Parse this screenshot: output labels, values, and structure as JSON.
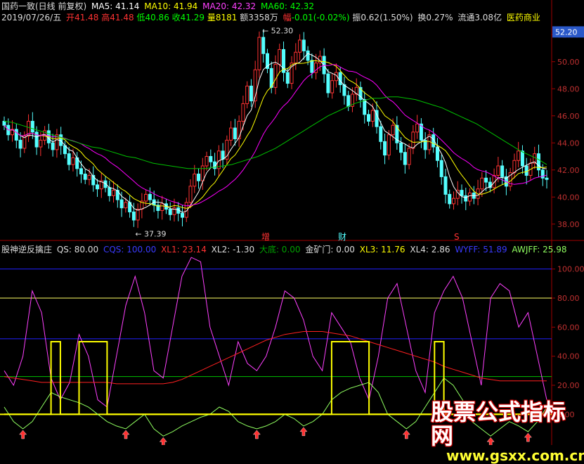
{
  "header": {
    "title": "国药一致(日线 前复权)",
    "ma5": "MA5: 41.14",
    "ma10": "MA10: 41.94",
    "ma20": "MA20: 42.32",
    "ma60": "MA60: 42.32",
    "date": "2019/07/26/五",
    "open_label": "开",
    "open": "41.48",
    "high_label": "高",
    "high": "41.48",
    "low_label": "低",
    "low": "40.86",
    "close_label": "收",
    "close": "41.29",
    "vol_label": "量",
    "vol": "8181",
    "amount": "额3358万",
    "change_label": "幅",
    "change": "-0.01(-0.02%)",
    "amplitude": "振0.62(1.50%)",
    "turnover": "换0.27%",
    "float": "流通3.08亿",
    "industry": "医药商业"
  },
  "price_labels": {
    "high_mark": "52.30",
    "low_mark": "37.39",
    "current": "52.20",
    "event1": "增",
    "event2": "财",
    "event3": "S"
  },
  "indicator": {
    "name": "股神逆反擒庄",
    "qs": "QS: 80.00",
    "cqs": "CQS: 100.00",
    "xl1": "XL1: 23.14",
    "xl2": "XL2: -1.30",
    "dadi": "大底: 0.00",
    "jkm": "金矿门: 0.00",
    "xl3": "XL3: 11.76",
    "xl4": "XL4: 2.86",
    "wyff": "WYFF: 51.89",
    "awjff": "AWJFF: 25.98"
  },
  "watermark": {
    "text": "股票公式指标网",
    "url": "www.gsxx.com.cn"
  },
  "colors": {
    "up": "#ff3232",
    "down": "#54ffff",
    "ma5": "#ffffff",
    "ma10": "#ffff00",
    "ma20": "#ff00ff",
    "ma60": "#00c000"
  },
  "chart_data": [
    {
      "type": "candlestick",
      "title": "国药一致(日线 前复权)",
      "ylim": [
        37,
        53
      ],
      "yticks": [
        38,
        40,
        42,
        44,
        46,
        48,
        50,
        52
      ],
      "annotations": [
        {
          "label": "52.30",
          "value": 52.3
        },
        {
          "label": "37.39",
          "value": 37.39
        }
      ],
      "close": [
        45.3,
        44.6,
        45.0,
        44.2,
        43.6,
        44.5,
        45.6,
        44.8,
        43.7,
        44.2,
        44.9,
        44.0,
        43.5,
        44.6,
        43.8,
        43.2,
        42.4,
        42.9,
        42.1,
        41.7,
        41.3,
        41.6,
        40.9,
        40.6,
        41.2,
        40.7,
        40.1,
        40.5,
        39.8,
        39.2,
        39.6,
        38.9,
        38.3,
        39.1,
        39.7,
        40.2,
        39.8,
        39.4,
        39.0,
        39.5,
        39.1,
        38.7,
        39.2,
        38.8,
        38.5,
        39.6,
        40.8,
        41.7,
        41.2,
        42.3,
        43.0,
        42.6,
        42.1,
        43.4,
        42.8,
        44.2,
        45.1,
        44.3,
        45.6,
        46.9,
        48.2,
        47.1,
        49.4,
        51.8,
        50.6,
        49.5,
        48.1,
        49.8,
        50.9,
        49.2,
        48.4,
        49.9,
        50.7,
        51.6,
        50.8,
        50.1,
        49.2,
        49.9,
        50.4,
        49.1,
        47.7,
        48.6,
        49.2,
        48.3,
        47.5,
        46.7,
        47.6,
        48.1,
        47.2,
        46.1,
        45.6,
        46.4,
        45.2,
        44.1,
        43.1,
        44.6,
        45.3,
        44.0,
        43.3,
        42.4,
        43.6,
        44.8,
        45.4,
        44.2,
        43.5,
        44.6,
        43.7,
        42.7,
        41.5,
        40.2,
        39.5,
        39.9,
        40.5,
        40.1,
        39.7,
        40.3,
        39.9,
        40.6,
        41.4,
        41.1,
        40.7,
        41.6,
        42.3,
        41.5,
        40.8,
        41.8,
        42.7,
        43.4,
        42.3,
        41.6,
        42.5,
        43.2,
        42.0,
        41.4,
        41.3
      ],
      "ma60": [
        45.6,
        45.5,
        45.3,
        45.1,
        44.9,
        44.7,
        44.5,
        44.3,
        44.1,
        43.9,
        43.7,
        43.6,
        43.4,
        43.2,
        43.0,
        42.9,
        42.7,
        42.5,
        42.4,
        42.3,
        42.2,
        42.1,
        42.1,
        42.1,
        42.2,
        42.3,
        42.4,
        42.6,
        42.8,
        43.0,
        43.3,
        43.6,
        44.0,
        44.4,
        44.8,
        45.2,
        45.6,
        46.0,
        46.3,
        46.6,
        46.9,
        47.1,
        47.3,
        47.3,
        47.4,
        47.4,
        47.3,
        47.2,
        47.0,
        46.8,
        46.6,
        46.3,
        46.0,
        45.7,
        45.4,
        45.0,
        44.6,
        44.2,
        43.8,
        43.4,
        43.1,
        42.8,
        42.4
      ]
    },
    {
      "type": "line",
      "title": "股神逆反擒庄",
      "ylim": [
        -10,
        110
      ],
      "yticks": [
        0,
        20,
        40,
        60,
        80,
        100
      ],
      "reference_lines": [
        {
          "value": 100,
          "color": "#2020ff"
        },
        {
          "value": 80,
          "color": "#ffff66"
        },
        {
          "value": 52,
          "color": "#2020ff"
        },
        {
          "value": 26,
          "color": "#00c000"
        },
        {
          "value": 0,
          "color": "#ffff00"
        }
      ],
      "series": [
        {
          "name": "QS",
          "color": "#ff40ff",
          "values": [
            30,
            20,
            40,
            85,
            70,
            25,
            10,
            22,
            55,
            40,
            10,
            5,
            40,
            75,
            95,
            70,
            30,
            25,
            60,
            95,
            108,
            105,
            60,
            40,
            20,
            50,
            35,
            30,
            40,
            60,
            85,
            80,
            65,
            40,
            30,
            70,
            60,
            50,
            25,
            10,
            40,
            80,
            90,
            60,
            30,
            15,
            70,
            85,
            95,
            80,
            50,
            20,
            80,
            90,
            85,
            60,
            70,
            40,
            10
          ]
        },
        {
          "name": "XL1",
          "color": "#ff2020",
          "values": [
            26,
            25,
            24,
            23,
            22,
            22,
            22,
            22,
            22,
            22,
            22,
            22,
            21,
            21,
            21,
            21,
            21,
            21,
            22,
            24,
            27,
            30,
            33,
            36,
            39,
            42,
            45,
            48,
            51,
            53,
            55,
            56,
            57,
            57,
            57,
            56,
            55,
            54,
            52,
            50,
            48,
            46,
            44,
            42,
            40,
            38,
            36,
            33,
            31,
            29,
            27,
            25,
            24,
            23,
            23,
            23,
            23,
            23,
            23
          ]
        },
        {
          "name": "AWJFF",
          "color": "#90ff60",
          "values": [
            5,
            -5,
            -10,
            -5,
            5,
            15,
            12,
            10,
            8,
            5,
            0,
            -5,
            -8,
            -10,
            -5,
            0,
            -10,
            -15,
            -12,
            -8,
            -5,
            -2,
            0,
            5,
            2,
            -5,
            -8,
            -10,
            -8,
            -5,
            0,
            -3,
            -8,
            -5,
            0,
            10,
            15,
            18,
            20,
            22,
            15,
            0,
            -5,
            -10,
            -5,
            5,
            15,
            25,
            20,
            10,
            -5,
            -10,
            -15,
            -10,
            -5,
            -8,
            -12,
            -5,
            5
          ]
        },
        {
          "name": "XL2",
          "color": "#ffff00",
          "values": [
            0,
            0,
            0,
            0,
            0,
            50,
            0,
            0,
            50,
            50,
            50,
            0,
            0,
            0,
            0,
            0,
            0,
            0,
            0,
            0,
            0,
            0,
            0,
            0,
            0,
            0,
            0,
            0,
            0,
            0,
            0,
            0,
            0,
            0,
            0,
            50,
            50,
            50,
            50,
            0,
            0,
            0,
            0,
            0,
            0,
            0,
            50,
            0,
            0,
            0,
            0,
            0,
            0,
            0,
            0,
            0,
            0,
            0,
            0
          ]
        }
      ]
    }
  ]
}
